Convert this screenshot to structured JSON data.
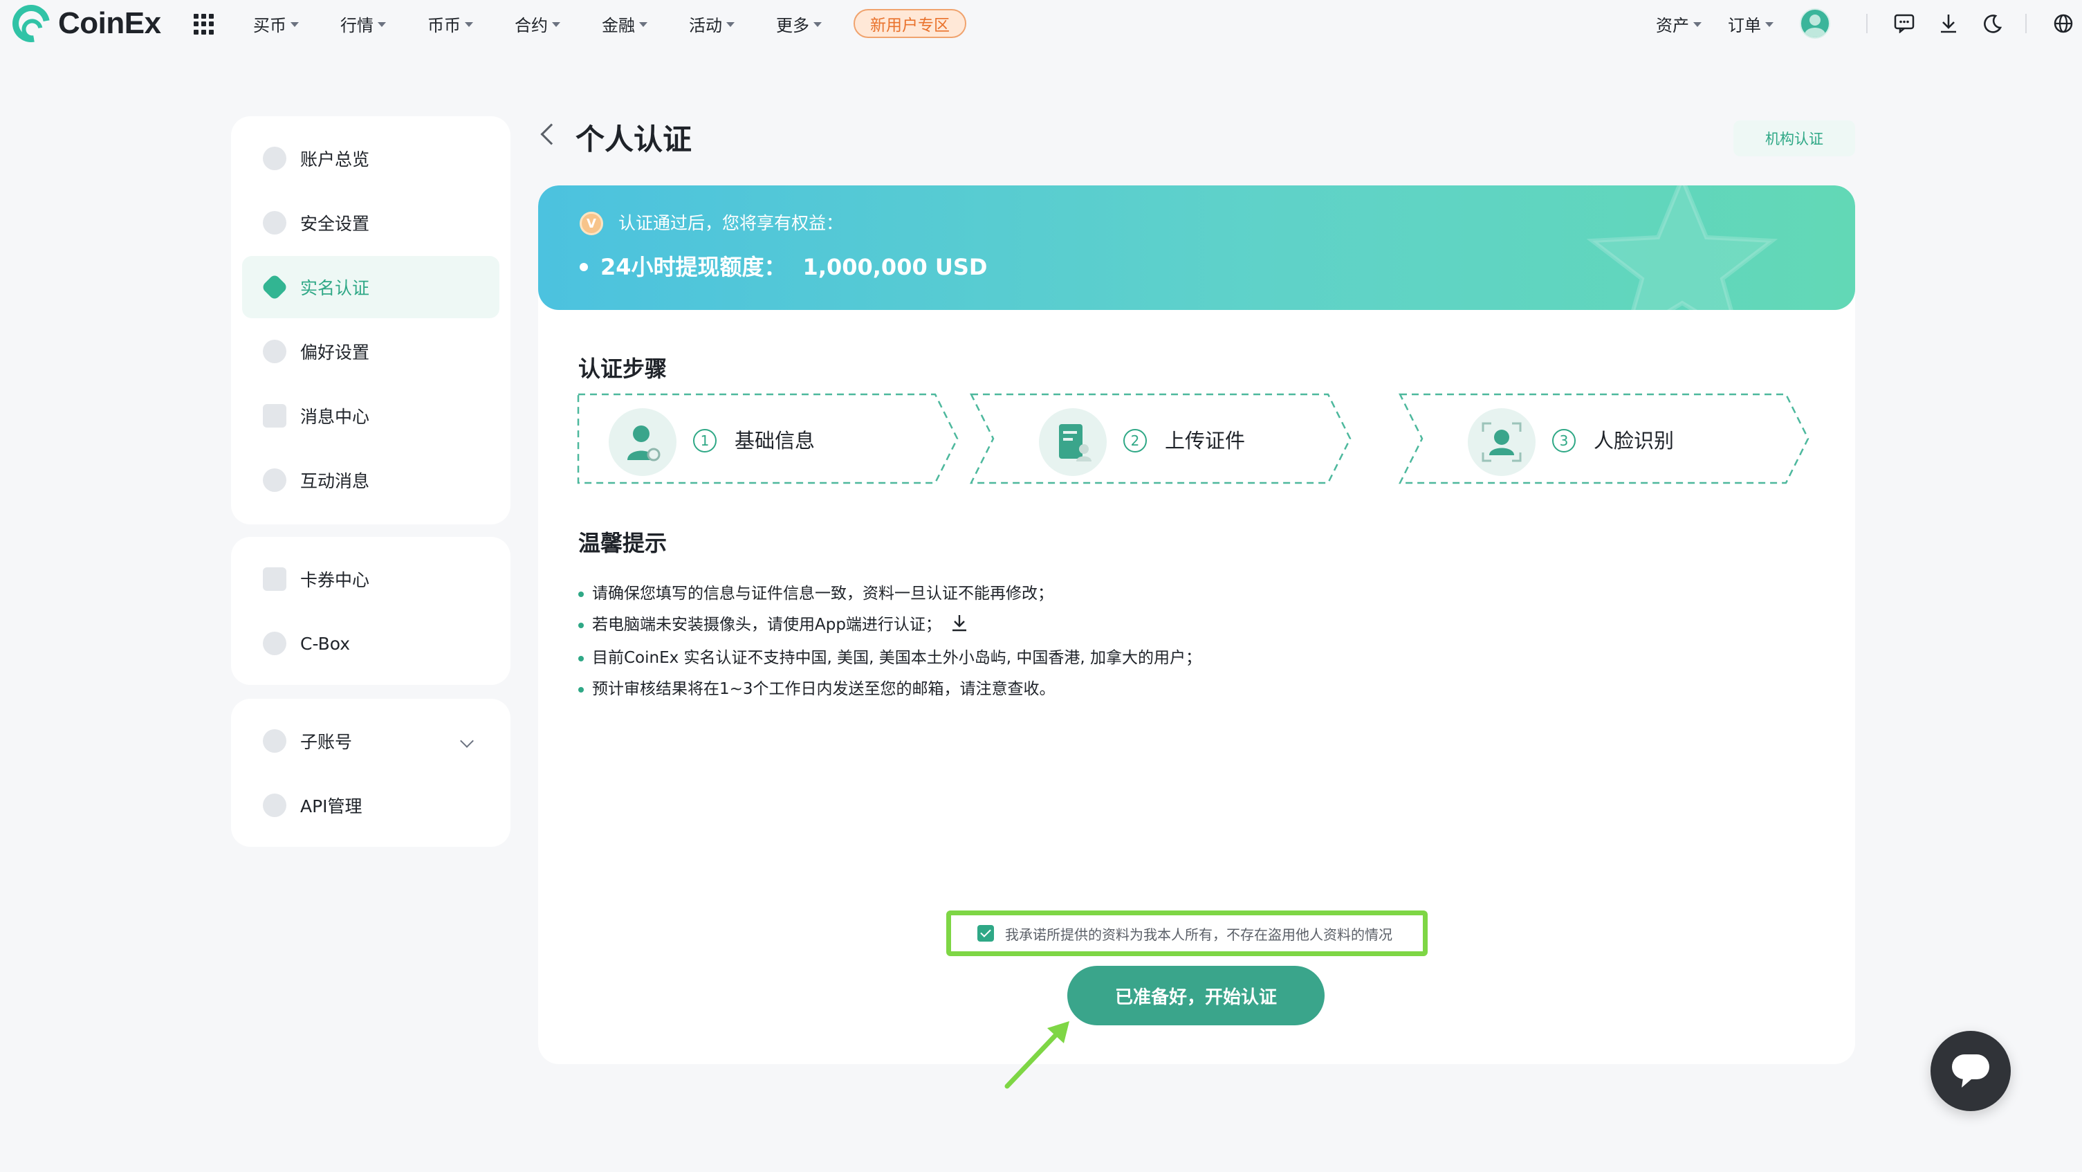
{
  "brand": {
    "name": "CoinEx",
    "accent": "#30c3a6"
  },
  "nav": {
    "items": [
      "买币",
      "行情",
      "币币",
      "合约",
      "金融",
      "活动",
      "更多"
    ],
    "promo": "新用户专区",
    "right": {
      "assets": "资产",
      "orders": "订单"
    },
    "icons": [
      "apps-grid-icon",
      "message-icon",
      "download-icon",
      "moon-icon",
      "globe-icon"
    ]
  },
  "sidebar": {
    "group1": [
      "账户总览",
      "安全设置",
      "实名认证",
      "偏好设置",
      "消息中心",
      "互动消息"
    ],
    "group2": [
      "卡券中心",
      "C-Box"
    ],
    "group3": [
      "子账号",
      "API管理"
    ],
    "active": "实名认证"
  },
  "page": {
    "title": "个人认证",
    "org_button": "机构认证",
    "banner": {
      "badge": "V",
      "subtitle": "认证通过后，您将享有权益：",
      "benefit_label": "24小时提现额度：",
      "benefit_value": "1,000,000 USD"
    },
    "steps_title": "认证步骤",
    "steps": [
      {
        "num": "1",
        "label": "基础信息"
      },
      {
        "num": "2",
        "label": "上传证件"
      },
      {
        "num": "3",
        "label": "人脸识别"
      }
    ],
    "tips_title": "温馨提示",
    "tips": [
      "请确保您填写的信息与证件信息一致，资料一旦认证不能再修改；",
      "若电脑端未安装摄像头，请使用App端进行认证；",
      "目前CoinEx 实名认证不支持中国, 美国, 美国本土外小岛屿, 中国香港, 加拿大的用户；",
      "预计审核结果将在1~3个工作日内发送至您的邮箱，请注意查收。"
    ],
    "confirm_text": "我承诺所提供的资料为我本人所有，不存在盗用他人资料的情况",
    "confirm_checked": true,
    "start_button": "已准备好，开始认证"
  }
}
